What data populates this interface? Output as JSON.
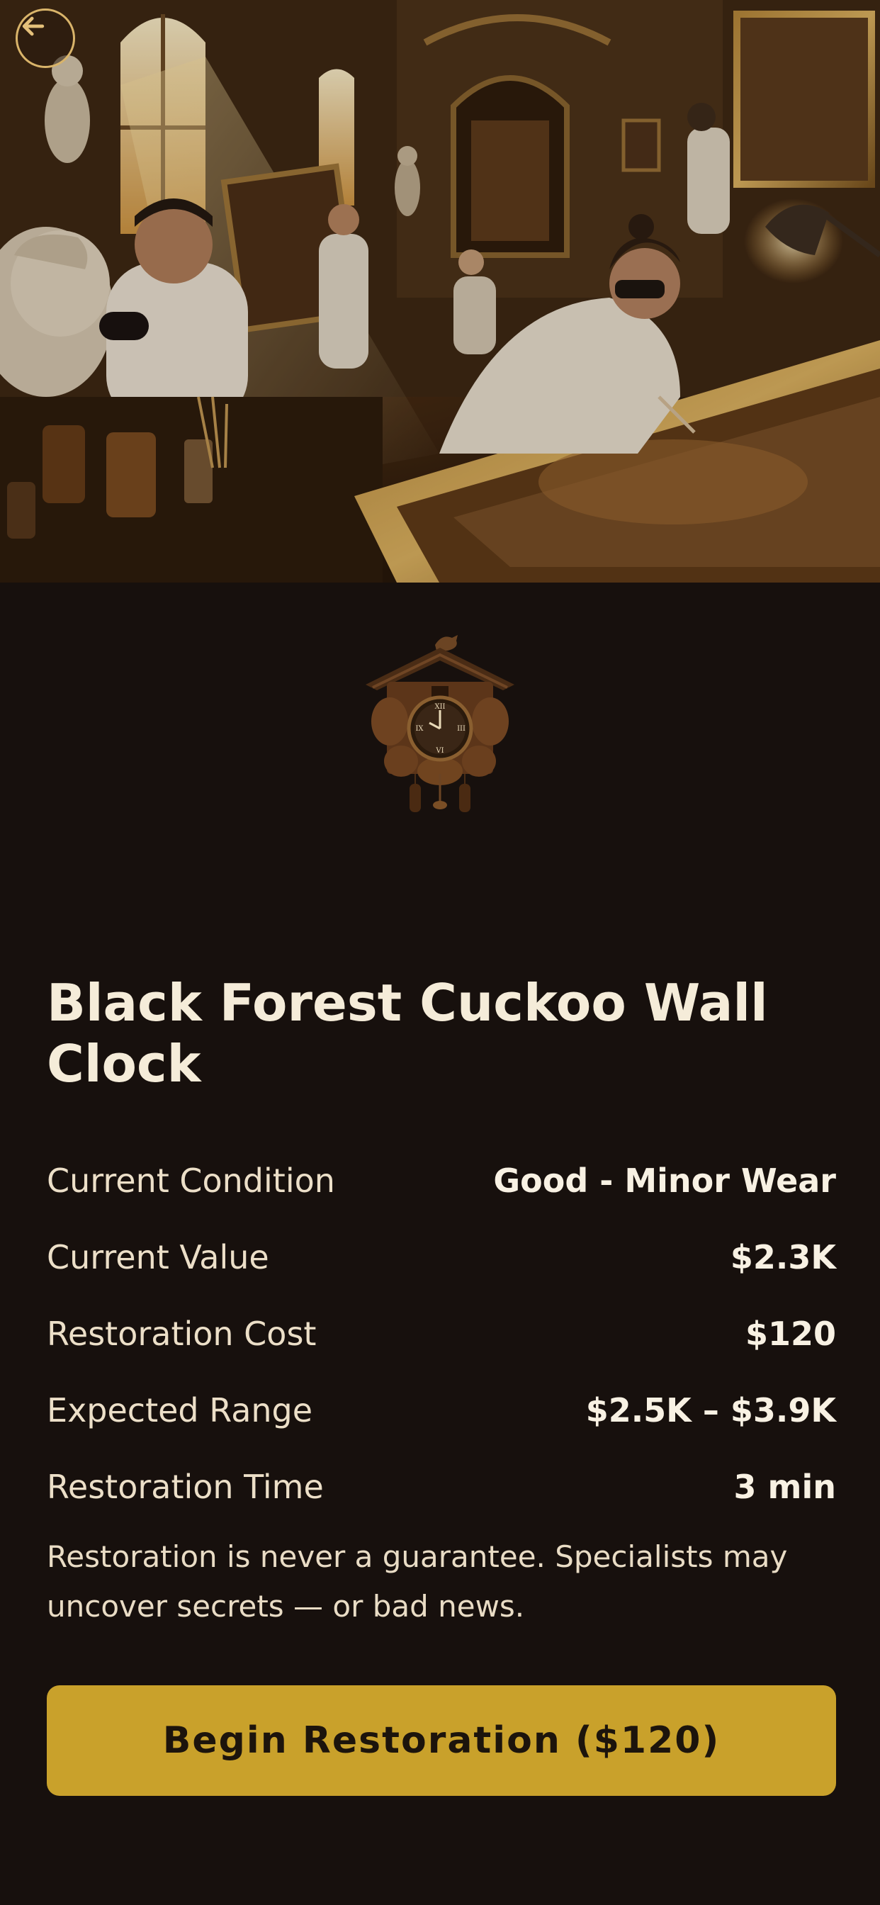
{
  "hero": {
    "back_icon": "arrow-left-icon",
    "accent_color": "#d9b46a"
  },
  "item": {
    "title": "Black Forest Cuckoo Wall Clock",
    "illustration_icon": "cuckoo-clock-icon"
  },
  "details": [
    {
      "label": "Current Condition",
      "value": "Good - Minor Wear"
    },
    {
      "label": "Current Value",
      "value": "$2.3K"
    },
    {
      "label": "Restoration Cost",
      "value": "$120"
    },
    {
      "label": "Expected Range",
      "value": "$2.5K – $3.9K"
    },
    {
      "label": "Restoration Time",
      "value": "3 min"
    }
  ],
  "disclaimer": "Restoration is never a guarantee. Specialists may uncover secrets — or bad news.",
  "cta": {
    "label": "Begin Restoration ($120)",
    "color": "#c9a12b"
  },
  "colors": {
    "background": "#17100d",
    "text": "#f3ead9"
  }
}
